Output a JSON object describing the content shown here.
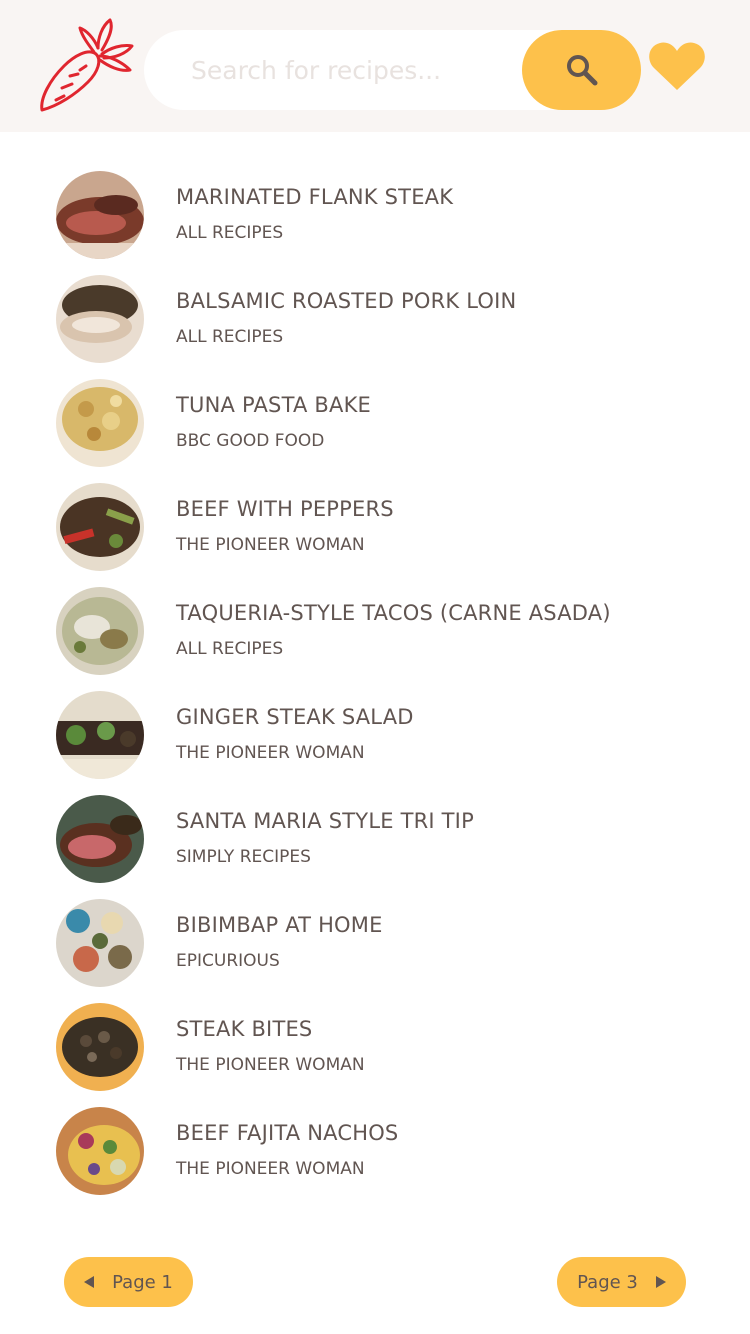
{
  "search": {
    "placeholder": "Search for recipes..."
  },
  "icons": {
    "logo": "carrot-icon",
    "search": "magnifier-icon",
    "favorites": "heart-icon"
  },
  "colors": {
    "accent": "#fdc14b",
    "header_bg": "#f9f5f3",
    "text": "#615551",
    "logo_red": "#e0262f"
  },
  "results": [
    {
      "title": "MARINATED FLANK STEAK",
      "source": "ALL RECIPES"
    },
    {
      "title": "BALSAMIC ROASTED PORK LOIN",
      "source": "ALL RECIPES"
    },
    {
      "title": "TUNA PASTA BAKE",
      "source": "BBC GOOD FOOD"
    },
    {
      "title": "BEEF WITH PEPPERS",
      "source": "THE PIONEER WOMAN"
    },
    {
      "title": "TAQUERIA-STYLE TACOS (CARNE ASADA)",
      "source": "ALL RECIPES"
    },
    {
      "title": "GINGER STEAK SALAD",
      "source": "THE PIONEER WOMAN"
    },
    {
      "title": "SANTA MARIA STYLE TRI TIP",
      "source": "SIMPLY RECIPES"
    },
    {
      "title": "BIBIMBAP AT HOME",
      "source": "EPICURIOUS"
    },
    {
      "title": "STEAK BITES",
      "source": "THE PIONEER WOMAN"
    },
    {
      "title": "BEEF FAJITA NACHOS",
      "source": "THE PIONEER WOMAN"
    }
  ],
  "pagination": {
    "prev_label": "Page 1",
    "next_label": "Page 3"
  }
}
